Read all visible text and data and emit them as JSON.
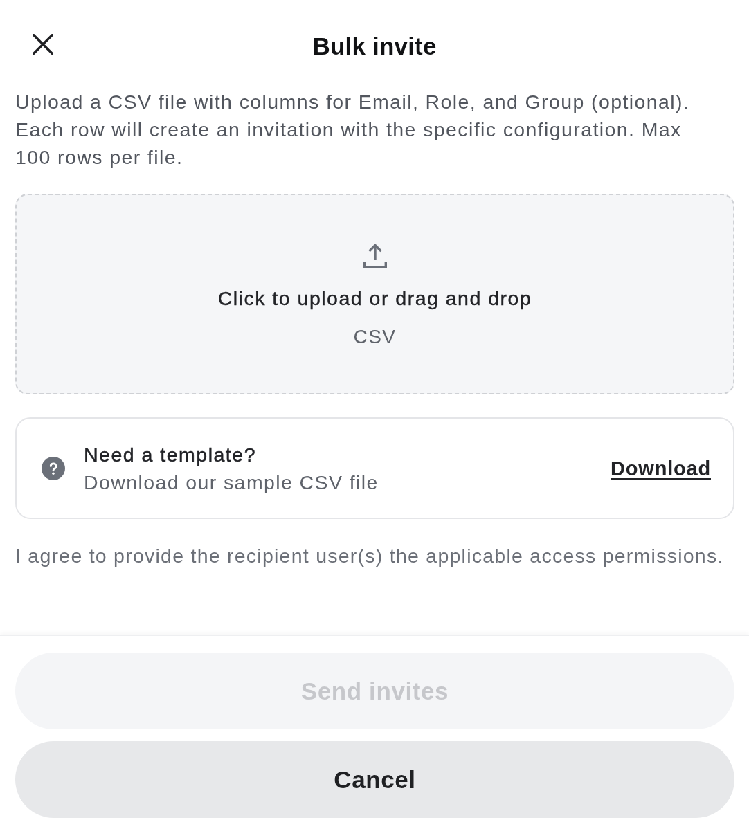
{
  "header": {
    "title": "Bulk invite"
  },
  "description": "Upload a CSV file with columns for Email, Role, and Group (optional). Each row will create an invitation with the specific configuration. Max 100 rows per file.",
  "dropzone": {
    "label": "Click to upload or drag and drop",
    "file_types": "CSV"
  },
  "template_card": {
    "title": "Need a template?",
    "subtitle": "Download our sample CSV file",
    "link": "Download"
  },
  "agreement": "I agree to provide the recipient user(s) the applicable access permissions.",
  "buttons": [
    {
      "label": "Send invites",
      "kind": "primary",
      "disabled": true
    },
    {
      "label": "Cancel",
      "kind": "secondary",
      "disabled": false
    }
  ]
}
